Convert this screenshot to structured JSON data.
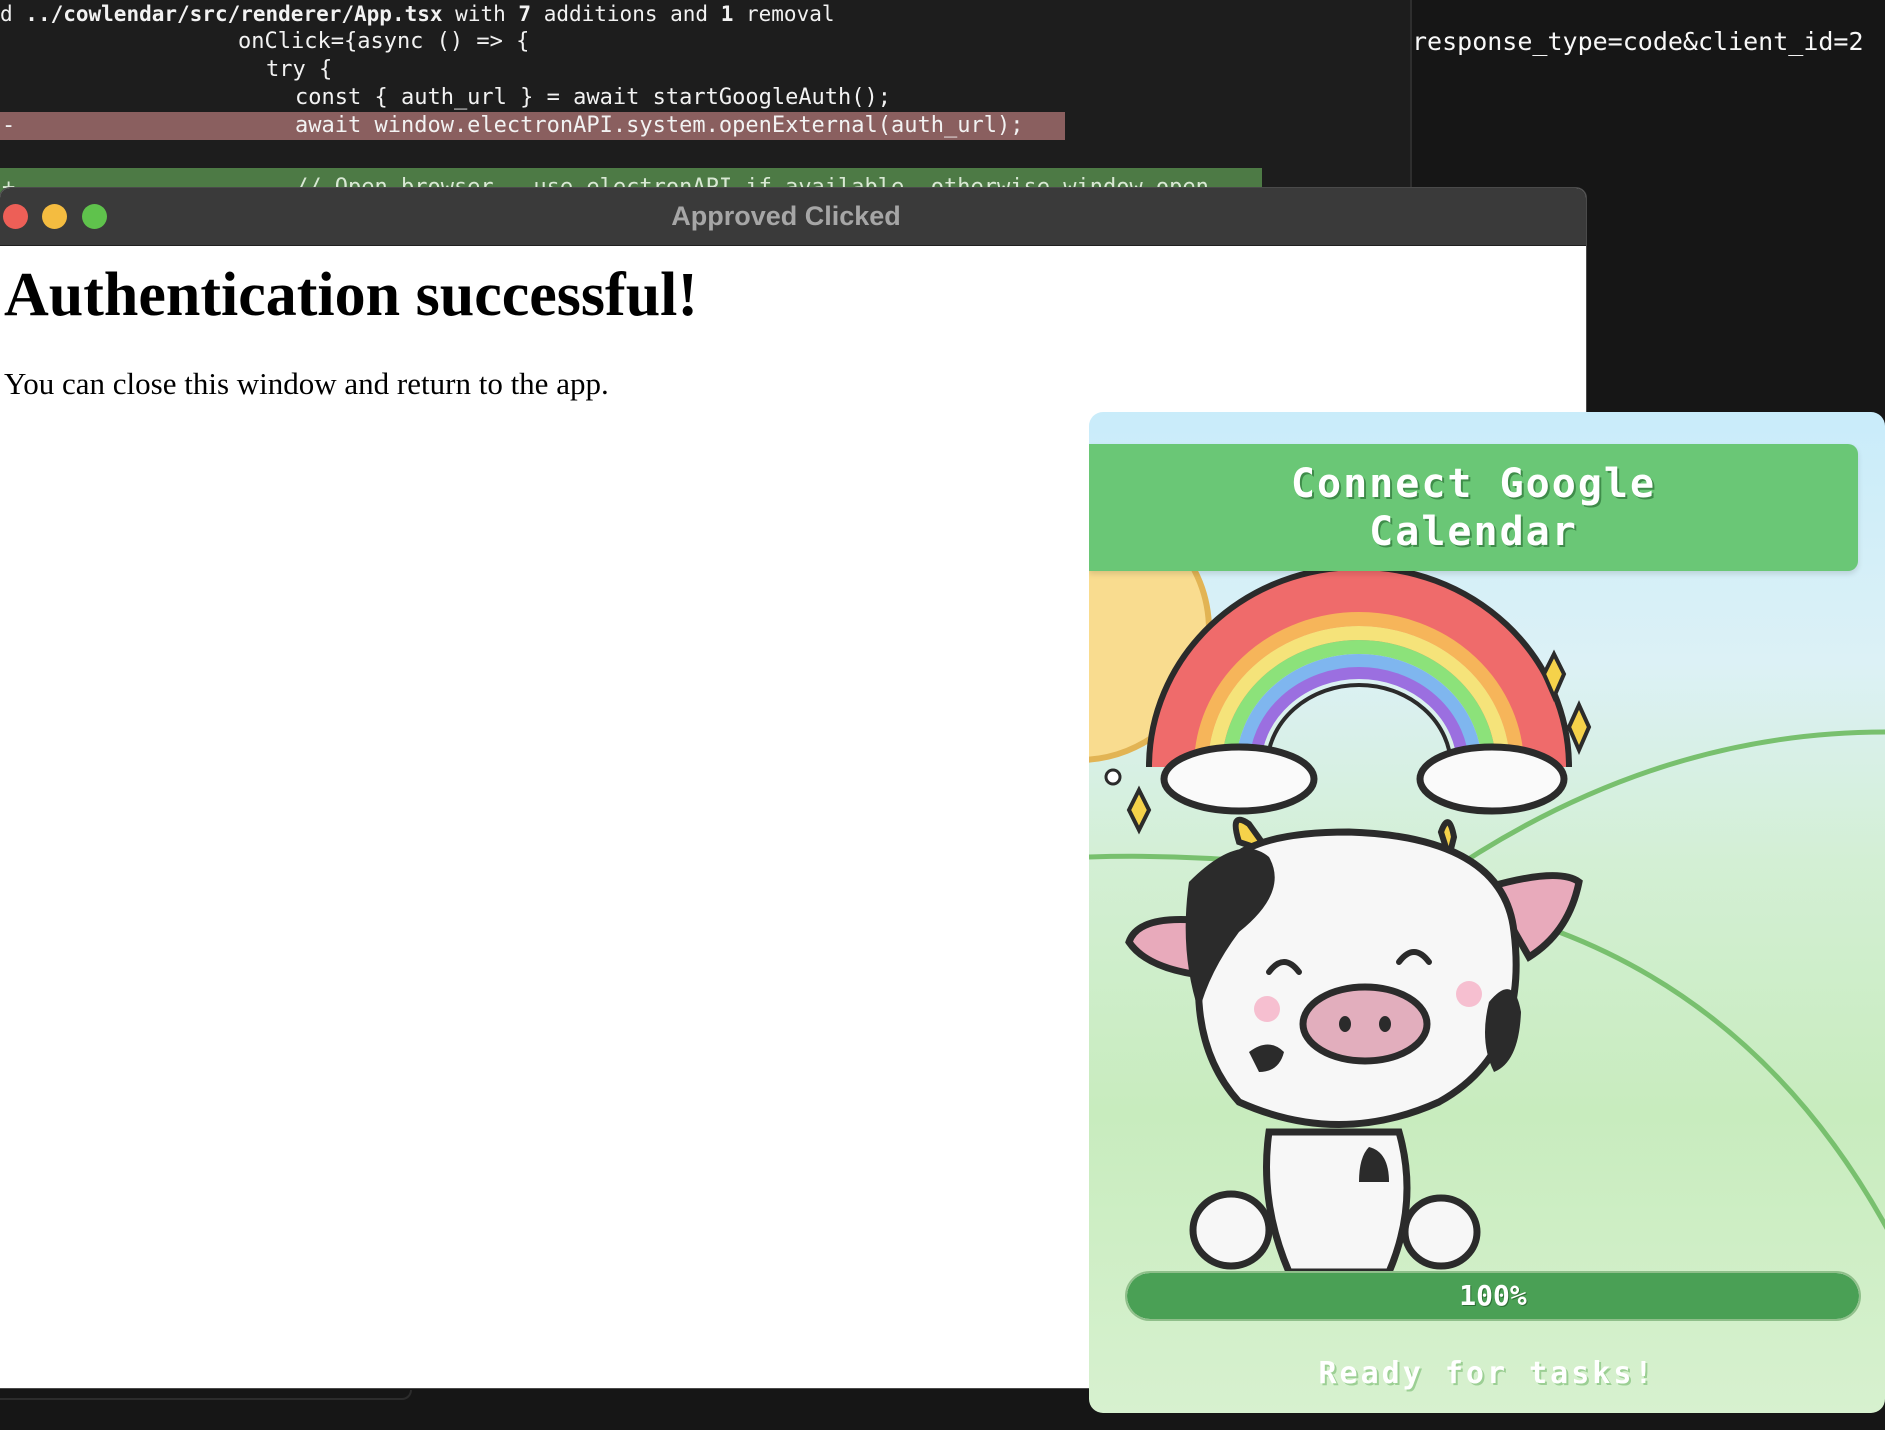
{
  "terminal": {
    "header": {
      "prefix": "d ",
      "file": "../cowlendar/src/renderer/App.tsx",
      "with": " with ",
      "additions_count": "7",
      "additions_label": " additions and ",
      "removals_count": "1",
      "removals_label": " removal"
    },
    "lines": [
      {
        "code": "onClick={async () => {"
      },
      {
        "code": "try {"
      },
      {
        "code": "const { auth_url } = await startGoogleAuth();"
      }
    ],
    "removed": {
      "marker": "-",
      "code": "await window.electronAPI.system.openExternal(auth_url);"
    },
    "added": {
      "marker": "+",
      "code": "// Open browser - use electronAPI if available, otherwise window.open"
    },
    "right_text": "response_type=code&client_id=2"
  },
  "browser_window": {
    "title": "Approved Clicked",
    "heading": "Authentication successful!",
    "message": "You can close this window and return to the app."
  },
  "cow_app": {
    "connect_button": "Connect Google Calendar",
    "progress": {
      "value": 1.0,
      "label": "100%"
    },
    "status": "Ready for tasks!",
    "colors": {
      "button": "#6ac776",
      "progress_fill": "#4aa055",
      "sky": "#c9ecfa",
      "grass": "#c8ecbe",
      "sun": "#f9dc8f"
    },
    "illustration": [
      "sun",
      "rainbow",
      "sparkles",
      "cow",
      "hills"
    ]
  }
}
